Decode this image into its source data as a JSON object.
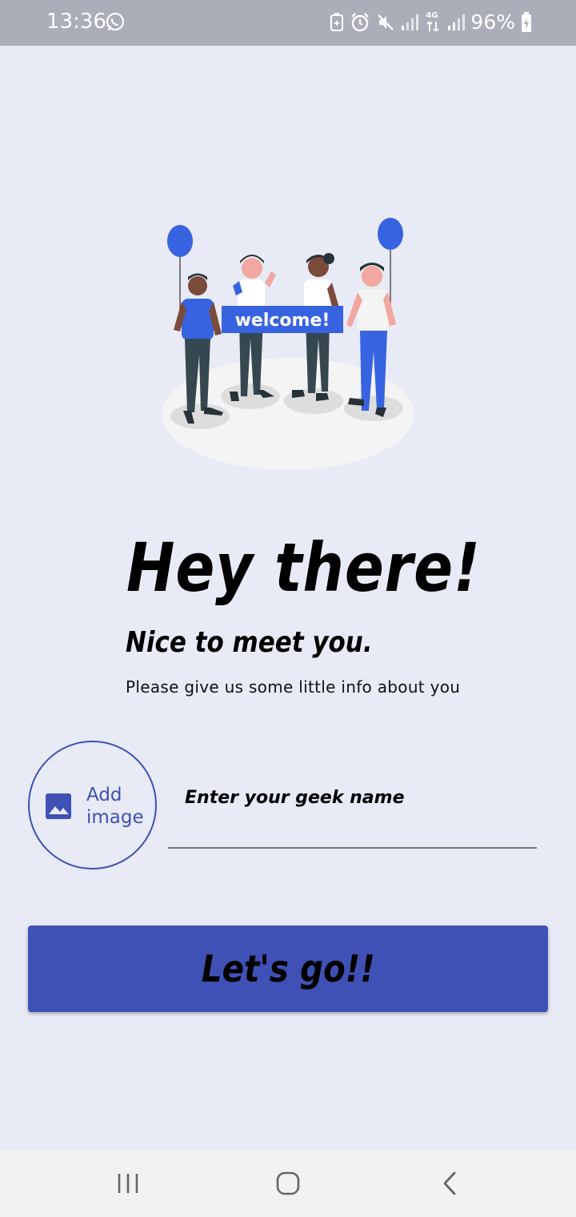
{
  "status_bar": {
    "time": "13:36",
    "battery_percent": "96%",
    "network_label": "4G",
    "icons": [
      "whatsapp-icon",
      "battery-saver-icon",
      "alarm-icon",
      "mute-icon",
      "signal-icon",
      "4g-signal-icon",
      "battery-charging-icon"
    ]
  },
  "illustration": {
    "banner_text": "welcome!",
    "accent_color": "#3763e0"
  },
  "main": {
    "title": "Hey there!",
    "subtitle": "Nice to meet you.",
    "info": "Please give us some little info about you"
  },
  "add_image": {
    "label": "Add image",
    "icon": "image-icon"
  },
  "name_input": {
    "placeholder": "Enter your geek name",
    "value": ""
  },
  "submit_button": {
    "label": "Let's go!!"
  },
  "nav_bar": {
    "icons": [
      "recent-apps-icon",
      "home-icon",
      "back-icon"
    ]
  },
  "colors": {
    "background": "#e8eaf6",
    "primary": "#3f51b5",
    "status_bar": "#abadb8"
  }
}
